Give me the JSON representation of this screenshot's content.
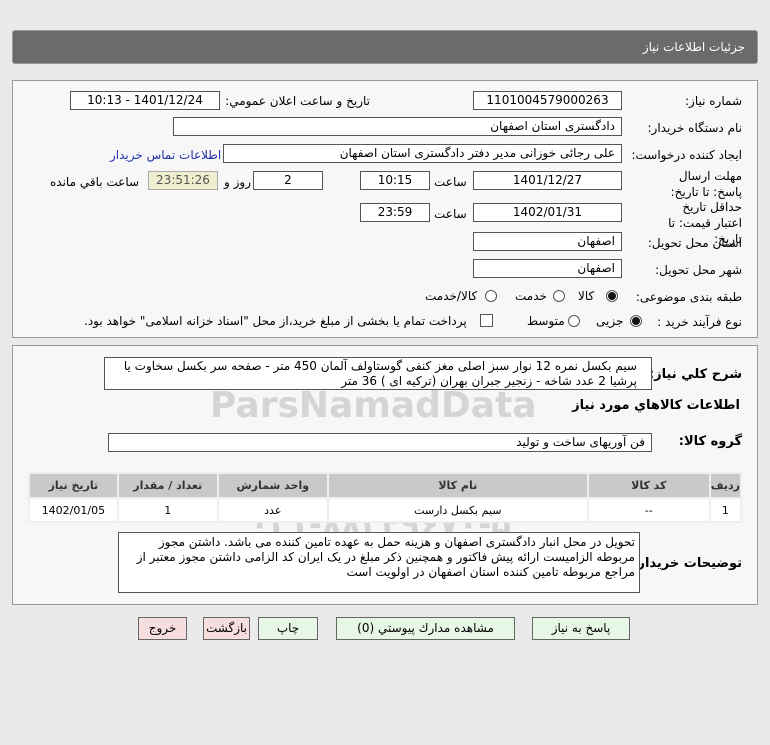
{
  "header": {
    "title": "جزئیات اطلاعات نیاز"
  },
  "form": {
    "need_number_label": "شماره نیاز:",
    "need_number": "1101004579000263",
    "announce_label": "تاریخ و ساعت اعلان عمومي:",
    "announce_value": "1401/12/24 - 10:13",
    "buyer_label": "نام دستگاه خریدار:",
    "buyer": "دادگستری استان اصفهان",
    "creator_label": "ایجاد کننده درخواست:",
    "creator": "علی رجائی خوزانی مدیر دفتر دادگستری استان اصفهان",
    "contact_link": "اطلاعات تماس خریدار",
    "deadline_label": "مهلت ارسال پاسخ: تا تاریخ:",
    "deadline_date": "1401/12/27",
    "time_label": "ساعت",
    "deadline_time": "10:15",
    "days": "2",
    "days_label": "روز و",
    "countdown": "23:51:26",
    "remaining_label": "ساعت باقي مانده",
    "validity_label": "حداقل تاریخ اعتبار قیمت: تا تاریخ:",
    "validity_date": "1402/01/31",
    "validity_time": "23:59",
    "province_label": "استان محل تحویل:",
    "province": "اصفهان",
    "city_label": "شهر محل تحویل:",
    "city": "اصفهان",
    "category_label": "طبقه بندی موضوعی:",
    "category_options": [
      "کالا",
      "خدمت",
      "کالا/خدمت"
    ],
    "category_selected": "کالا",
    "process_label": "نوع فرآیند خرید :",
    "process_options": [
      "جزیی",
      "متوسط"
    ],
    "process_selected": "جزیی",
    "payment_note": "پرداخت تمام یا بخشی از مبلغ خرید،از محل \"اسناد خزانه اسلامی\" خواهد بود."
  },
  "details": {
    "summary_label": "شرح كلي نياز:",
    "summary": "سیم بکسل نمره 12  نوار سبز اصلی مغز کنفی گوستاولف آلمان 450 متر - صفحه سر بکسل سخاوت یا پرشیا 2 عدد شاخه - زنجیر جبران بهران (ترکیه ای ) 36 متر",
    "goods_title": "اطلاعات كالاهاي مورد نياز",
    "group_label": "گروه کالا:",
    "group": "فن آوریهای ساخت و تولید",
    "table": {
      "headers": [
        "ردیف",
        "کد کالا",
        "نام کالا",
        "واحد شمارش",
        "تعداد / مقدار",
        "تاریخ نیاز"
      ],
      "rows": [
        [
          "1",
          "--",
          "سیم بکسل دارست",
          "عدد",
          "1",
          "1402/01/05"
        ]
      ]
    },
    "notes_label": "توضیحات خریدار:",
    "notes": "تحویل در محل انبار دادگستری اصفهان و هزینه حمل به عهده تامین کننده می باشد. داشتن مجوز مربوطه الزامیست  ارائه پیش فاکتور و همچنین ذکر مبلغ در یک ایران کد الزامی  داشتن مجوز معتبر از مراجع مربوطه تامین کننده استان اصفهان در اولویت است"
  },
  "buttons": {
    "reply": "پاسخ به نیاز",
    "attachments": "مشاهده مدارك پيوستي (0)",
    "print": "چاپ",
    "back": "بازگشت",
    "exit": "خروج"
  },
  "watermark": {
    "brand": "ParsNamadData",
    "phone": "۰۲۱-۸۸۳۴۹۶۷۰-۵"
  }
}
